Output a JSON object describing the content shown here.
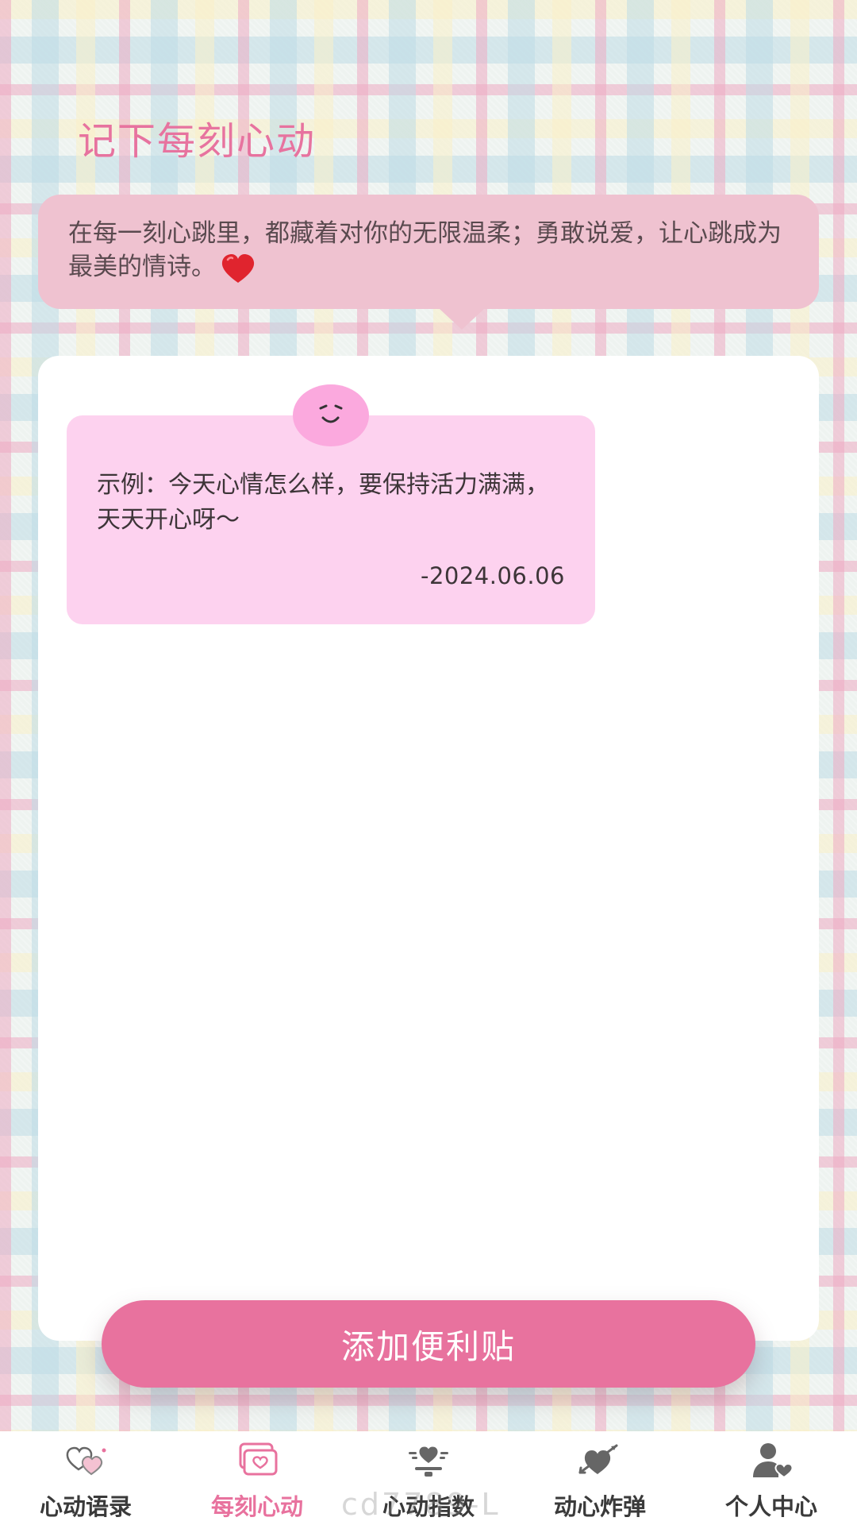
{
  "page": {
    "title": "记下每刻心动",
    "quote": "在每一刻心跳里，都藏着对你的无限温柔；勇敢说爱，让心跳成为最美的情诗。",
    "quote_emoji": "red-heart"
  },
  "note": {
    "face_icon": "smile-face-icon",
    "text": "示例：今天心情怎么样，要保持活力满满，天天开心呀～",
    "date": "-2024.06.06"
  },
  "actions": {
    "add_label": "添加便利贴"
  },
  "nav": {
    "items": [
      {
        "label": "心动语录",
        "icon": "hearts-icon",
        "active": false
      },
      {
        "label": "每刻心动",
        "icon": "card-heart-icon",
        "active": true
      },
      {
        "label": "心动指数",
        "icon": "heart-meter-icon",
        "active": false
      },
      {
        "label": "动心炸弹",
        "icon": "arrow-heart-icon",
        "active": false
      },
      {
        "label": "个人中心",
        "icon": "user-heart-icon",
        "active": false
      }
    ]
  },
  "watermark": "cd7789-L",
  "colors": {
    "accent": "#e8729e",
    "quote_bg": "#efc2d0",
    "note_bg": "#fdd2ef",
    "face": "#fba9de"
  }
}
